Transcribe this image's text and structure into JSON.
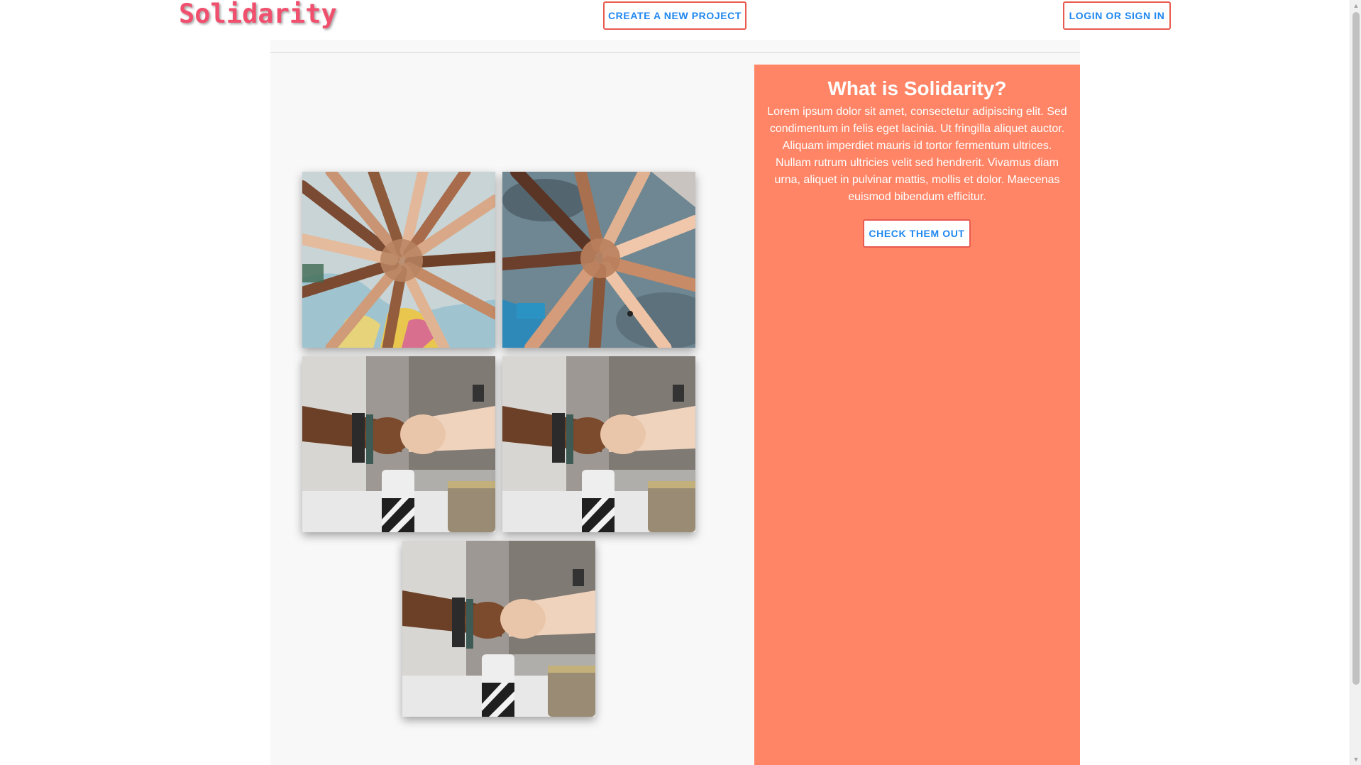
{
  "header": {
    "logo_text": "Solidarity",
    "create_button_label": "CREATE A NEW PROJECT",
    "login_button_label": "LOGIN OR SIGN IN"
  },
  "gallery": {
    "photos": [
      {
        "icon": "hands-stacked-map-photo"
      },
      {
        "icon": "hands-stacked-floor-photo"
      },
      {
        "icon": "fist-bump-photo"
      },
      {
        "icon": "fist-bump-photo"
      },
      {
        "icon": "fist-bump-photo"
      }
    ]
  },
  "panel": {
    "title": "What is Solidarity?",
    "text": "Lorem ipsum dolor sit amet, consectetur adipiscing elit. Sed condimentum in felis eget lacinia. Ut fringilla aliquet auctor. Aliquam imperdiet mauris id tortor fermentum ultrices. Nullam rutrum ultricies velit sed hendrerit. Vivamus diam urna, aliquet in pulvinar mattis, mollis et dolor. Maecenas euismod bibendum efficitur.",
    "button_label": "CHECK THEM OUT"
  },
  "colors": {
    "logo": "#f0506e",
    "button_text": "#1e87f0",
    "button_border": "#e85a4f",
    "panel_background": "#ff8566"
  }
}
